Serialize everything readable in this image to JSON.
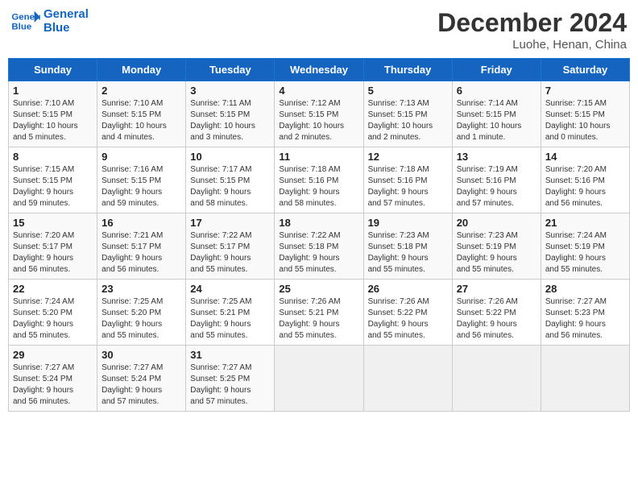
{
  "header": {
    "logo_line1": "General",
    "logo_line2": "Blue",
    "title": "December 2024",
    "subtitle": "Luohe, Henan, China"
  },
  "days_of_week": [
    "Sunday",
    "Monday",
    "Tuesday",
    "Wednesday",
    "Thursday",
    "Friday",
    "Saturday"
  ],
  "weeks": [
    [
      {
        "day": "1",
        "info": "Sunrise: 7:10 AM\nSunset: 5:15 PM\nDaylight: 10 hours\nand 5 minutes."
      },
      {
        "day": "2",
        "info": "Sunrise: 7:10 AM\nSunset: 5:15 PM\nDaylight: 10 hours\nand 4 minutes."
      },
      {
        "day": "3",
        "info": "Sunrise: 7:11 AM\nSunset: 5:15 PM\nDaylight: 10 hours\nand 3 minutes."
      },
      {
        "day": "4",
        "info": "Sunrise: 7:12 AM\nSunset: 5:15 PM\nDaylight: 10 hours\nand 2 minutes."
      },
      {
        "day": "5",
        "info": "Sunrise: 7:13 AM\nSunset: 5:15 PM\nDaylight: 10 hours\nand 2 minutes."
      },
      {
        "day": "6",
        "info": "Sunrise: 7:14 AM\nSunset: 5:15 PM\nDaylight: 10 hours\nand 1 minute."
      },
      {
        "day": "7",
        "info": "Sunrise: 7:15 AM\nSunset: 5:15 PM\nDaylight: 10 hours\nand 0 minutes."
      }
    ],
    [
      {
        "day": "8",
        "info": "Sunrise: 7:15 AM\nSunset: 5:15 PM\nDaylight: 9 hours\nand 59 minutes."
      },
      {
        "day": "9",
        "info": "Sunrise: 7:16 AM\nSunset: 5:15 PM\nDaylight: 9 hours\nand 59 minutes."
      },
      {
        "day": "10",
        "info": "Sunrise: 7:17 AM\nSunset: 5:15 PM\nDaylight: 9 hours\nand 58 minutes."
      },
      {
        "day": "11",
        "info": "Sunrise: 7:18 AM\nSunset: 5:16 PM\nDaylight: 9 hours\nand 58 minutes."
      },
      {
        "day": "12",
        "info": "Sunrise: 7:18 AM\nSunset: 5:16 PM\nDaylight: 9 hours\nand 57 minutes."
      },
      {
        "day": "13",
        "info": "Sunrise: 7:19 AM\nSunset: 5:16 PM\nDaylight: 9 hours\nand 57 minutes."
      },
      {
        "day": "14",
        "info": "Sunrise: 7:20 AM\nSunset: 5:16 PM\nDaylight: 9 hours\nand 56 minutes."
      }
    ],
    [
      {
        "day": "15",
        "info": "Sunrise: 7:20 AM\nSunset: 5:17 PM\nDaylight: 9 hours\nand 56 minutes."
      },
      {
        "day": "16",
        "info": "Sunrise: 7:21 AM\nSunset: 5:17 PM\nDaylight: 9 hours\nand 56 minutes."
      },
      {
        "day": "17",
        "info": "Sunrise: 7:22 AM\nSunset: 5:17 PM\nDaylight: 9 hours\nand 55 minutes."
      },
      {
        "day": "18",
        "info": "Sunrise: 7:22 AM\nSunset: 5:18 PM\nDaylight: 9 hours\nand 55 minutes."
      },
      {
        "day": "19",
        "info": "Sunrise: 7:23 AM\nSunset: 5:18 PM\nDaylight: 9 hours\nand 55 minutes."
      },
      {
        "day": "20",
        "info": "Sunrise: 7:23 AM\nSunset: 5:19 PM\nDaylight: 9 hours\nand 55 minutes."
      },
      {
        "day": "21",
        "info": "Sunrise: 7:24 AM\nSunset: 5:19 PM\nDaylight: 9 hours\nand 55 minutes."
      }
    ],
    [
      {
        "day": "22",
        "info": "Sunrise: 7:24 AM\nSunset: 5:20 PM\nDaylight: 9 hours\nand 55 minutes."
      },
      {
        "day": "23",
        "info": "Sunrise: 7:25 AM\nSunset: 5:20 PM\nDaylight: 9 hours\nand 55 minutes."
      },
      {
        "day": "24",
        "info": "Sunrise: 7:25 AM\nSunset: 5:21 PM\nDaylight: 9 hours\nand 55 minutes."
      },
      {
        "day": "25",
        "info": "Sunrise: 7:26 AM\nSunset: 5:21 PM\nDaylight: 9 hours\nand 55 minutes."
      },
      {
        "day": "26",
        "info": "Sunrise: 7:26 AM\nSunset: 5:22 PM\nDaylight: 9 hours\nand 55 minutes."
      },
      {
        "day": "27",
        "info": "Sunrise: 7:26 AM\nSunset: 5:22 PM\nDaylight: 9 hours\nand 56 minutes."
      },
      {
        "day": "28",
        "info": "Sunrise: 7:27 AM\nSunset: 5:23 PM\nDaylight: 9 hours\nand 56 minutes."
      }
    ],
    [
      {
        "day": "29",
        "info": "Sunrise: 7:27 AM\nSunset: 5:24 PM\nDaylight: 9 hours\nand 56 minutes."
      },
      {
        "day": "30",
        "info": "Sunrise: 7:27 AM\nSunset: 5:24 PM\nDaylight: 9 hours\nand 57 minutes."
      },
      {
        "day": "31",
        "info": "Sunrise: 7:27 AM\nSunset: 5:25 PM\nDaylight: 9 hours\nand 57 minutes."
      },
      {
        "day": "",
        "info": ""
      },
      {
        "day": "",
        "info": ""
      },
      {
        "day": "",
        "info": ""
      },
      {
        "day": "",
        "info": ""
      }
    ]
  ]
}
